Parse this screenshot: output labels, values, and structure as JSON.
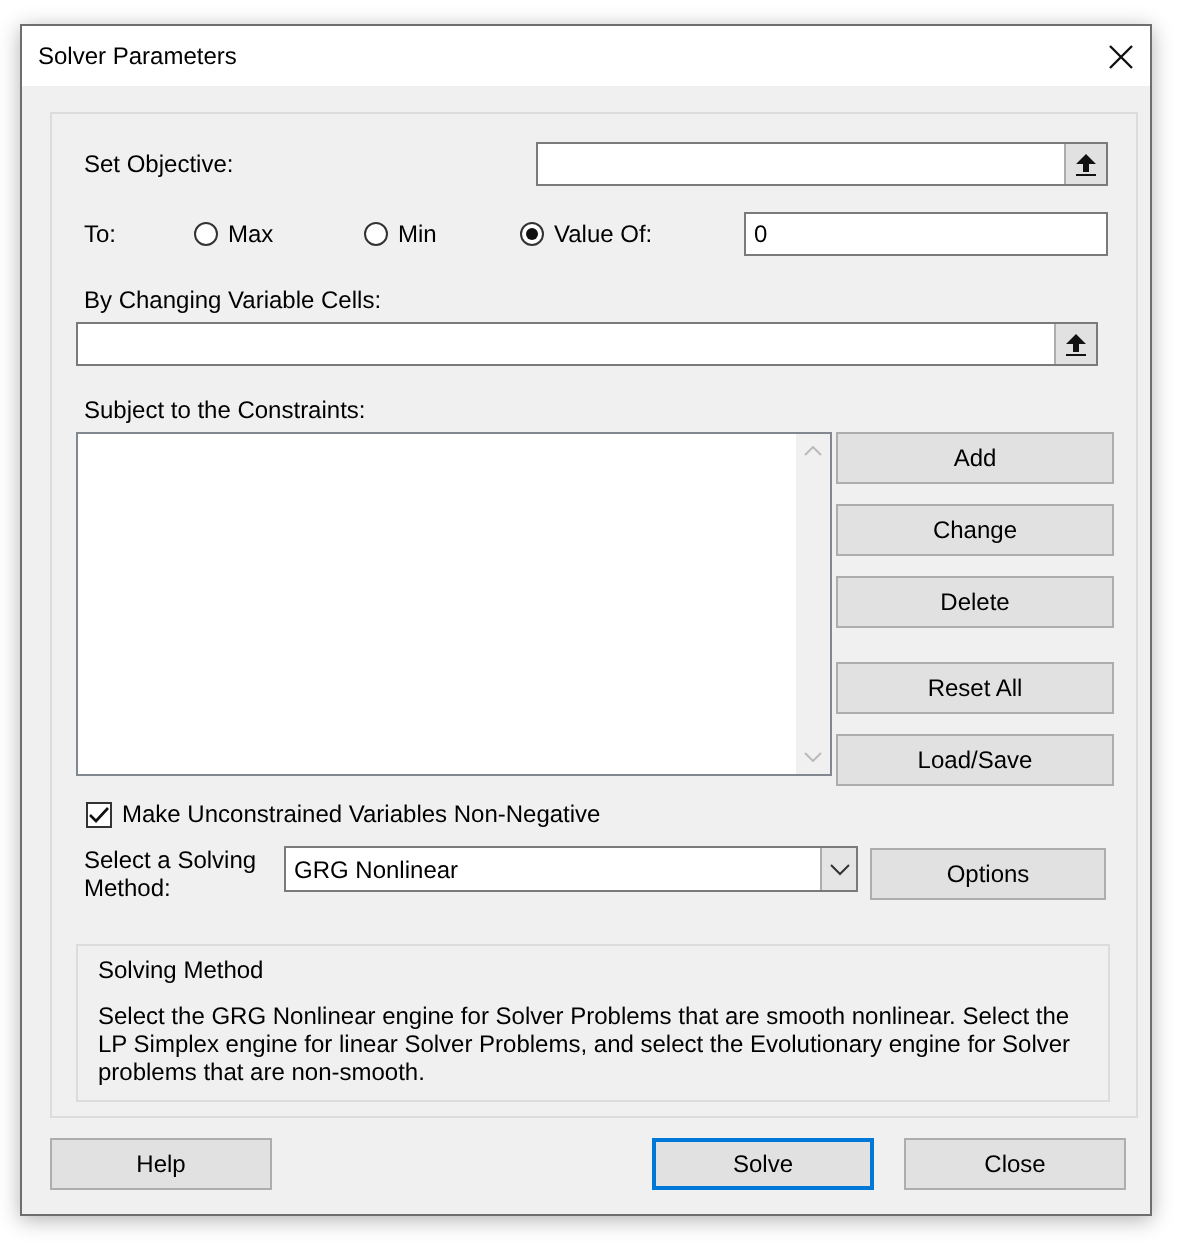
{
  "window": {
    "title": "Solver Parameters"
  },
  "objective": {
    "label": "Set Objective:"
  },
  "to": {
    "label": "To:",
    "options": [
      {
        "label": "Max",
        "selected": false
      },
      {
        "label": "Min",
        "selected": false
      },
      {
        "label": "Value Of:",
        "selected": true
      }
    ],
    "value": "0"
  },
  "changing_cells": {
    "label": "By Changing Variable Cells:"
  },
  "constraints": {
    "label": "Subject to the Constraints:"
  },
  "constraint_buttons": [
    [
      "Add",
      "Change",
      "Delete"
    ],
    [
      "Reset All",
      "Load/Save"
    ]
  ],
  "non_negative": {
    "label": "Make Unconstrained Variables Non-Negative",
    "checked": true
  },
  "method": {
    "label": "Select a Solving Method:",
    "value": "GRG Nonlinear"
  },
  "options_button": "Options",
  "description": {
    "title": "Solving Method",
    "text": "Select the GRG Nonlinear engine for Solver Problems that are smooth nonlinear. Select the LP Simplex engine for linear Solver Problems, and select the Evolutionary engine for Solver problems that are non-smooth."
  },
  "buttons": [
    {
      "label": "Help",
      "focused": false
    },
    {
      "label": "Solve",
      "focused": true
    },
    {
      "label": "Close",
      "focused": false
    }
  ]
}
